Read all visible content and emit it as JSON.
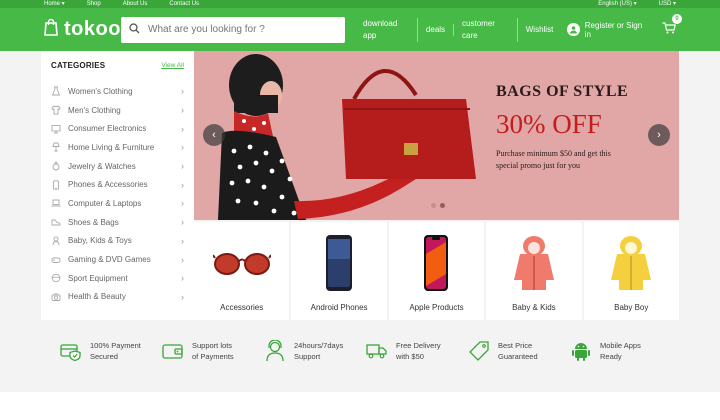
{
  "topbar": {
    "home": "Home ▾",
    "shop": "Shop",
    "about": "About Us",
    "contact": "Contact Us",
    "language": "English (US) ▾",
    "currency": "USD ▾"
  },
  "header": {
    "logo": "tokoo",
    "search_placeholder": "What are you looking for ?",
    "links": [
      "download app",
      "deals",
      "customer care",
      "Wishlist"
    ],
    "signin": "Register or Sign in",
    "cart_count": "0",
    "brand_color": "#46b946"
  },
  "sidebar": {
    "title": "CATEGORIES",
    "view_all": "View All",
    "items": [
      {
        "label": "Women's Clothing",
        "icon": "dress-icon"
      },
      {
        "label": "Men's Clothing",
        "icon": "shirt-icon"
      },
      {
        "label": "Consumer Electronics",
        "icon": "monitor-icon"
      },
      {
        "label": "Home Living & Furniture",
        "icon": "lamp-icon"
      },
      {
        "label": "Jewelry & Watches",
        "icon": "ring-icon"
      },
      {
        "label": "Phones & Accessories",
        "icon": "phone-icon"
      },
      {
        "label": "Computer & Laptops",
        "icon": "laptop-icon"
      },
      {
        "label": "Shoes & Bags",
        "icon": "shoe-icon"
      },
      {
        "label": "Baby, Kids & Toys",
        "icon": "baby-icon"
      },
      {
        "label": "Gaming & DVD Games",
        "icon": "gamepad-icon"
      },
      {
        "label": "Sport Equipment",
        "icon": "ball-icon"
      },
      {
        "label": "Health & Beauty",
        "icon": "camera-icon"
      }
    ]
  },
  "banner": {
    "title": "BAGS OF STYLE",
    "discount": "30% OFF",
    "subtitle": "Purchase minimum $50 and get this special promo just for you",
    "background": "#e1a6a6",
    "accent": "#c51d1d"
  },
  "products": [
    {
      "label": "Accessories",
      "icon": "sunglasses-icon"
    },
    {
      "label": "Android Phones",
      "icon": "android-phone-icon"
    },
    {
      "label": "Apple Products",
      "icon": "iphone-icon"
    },
    {
      "label": "Baby & Kids",
      "icon": "pink-jacket-icon"
    },
    {
      "label": "Baby Boy",
      "icon": "yellow-jacket-icon"
    }
  ],
  "features": [
    {
      "line1": "100% Payment",
      "line2": "Secured",
      "icon": "shield-icon"
    },
    {
      "line1": "Support lots",
      "line2": "of Payments",
      "icon": "wallet-icon"
    },
    {
      "line1": "24hours/7days",
      "line2": "Support",
      "icon": "support-agent-icon"
    },
    {
      "line1": "Free Delivery",
      "line2": "with $50",
      "icon": "truck-icon"
    },
    {
      "line1": "Best Price",
      "line2": "Guaranteed",
      "icon": "price-tag-icon"
    },
    {
      "line1": "Mobile Apps",
      "line2": "Ready",
      "icon": "android-icon"
    }
  ]
}
